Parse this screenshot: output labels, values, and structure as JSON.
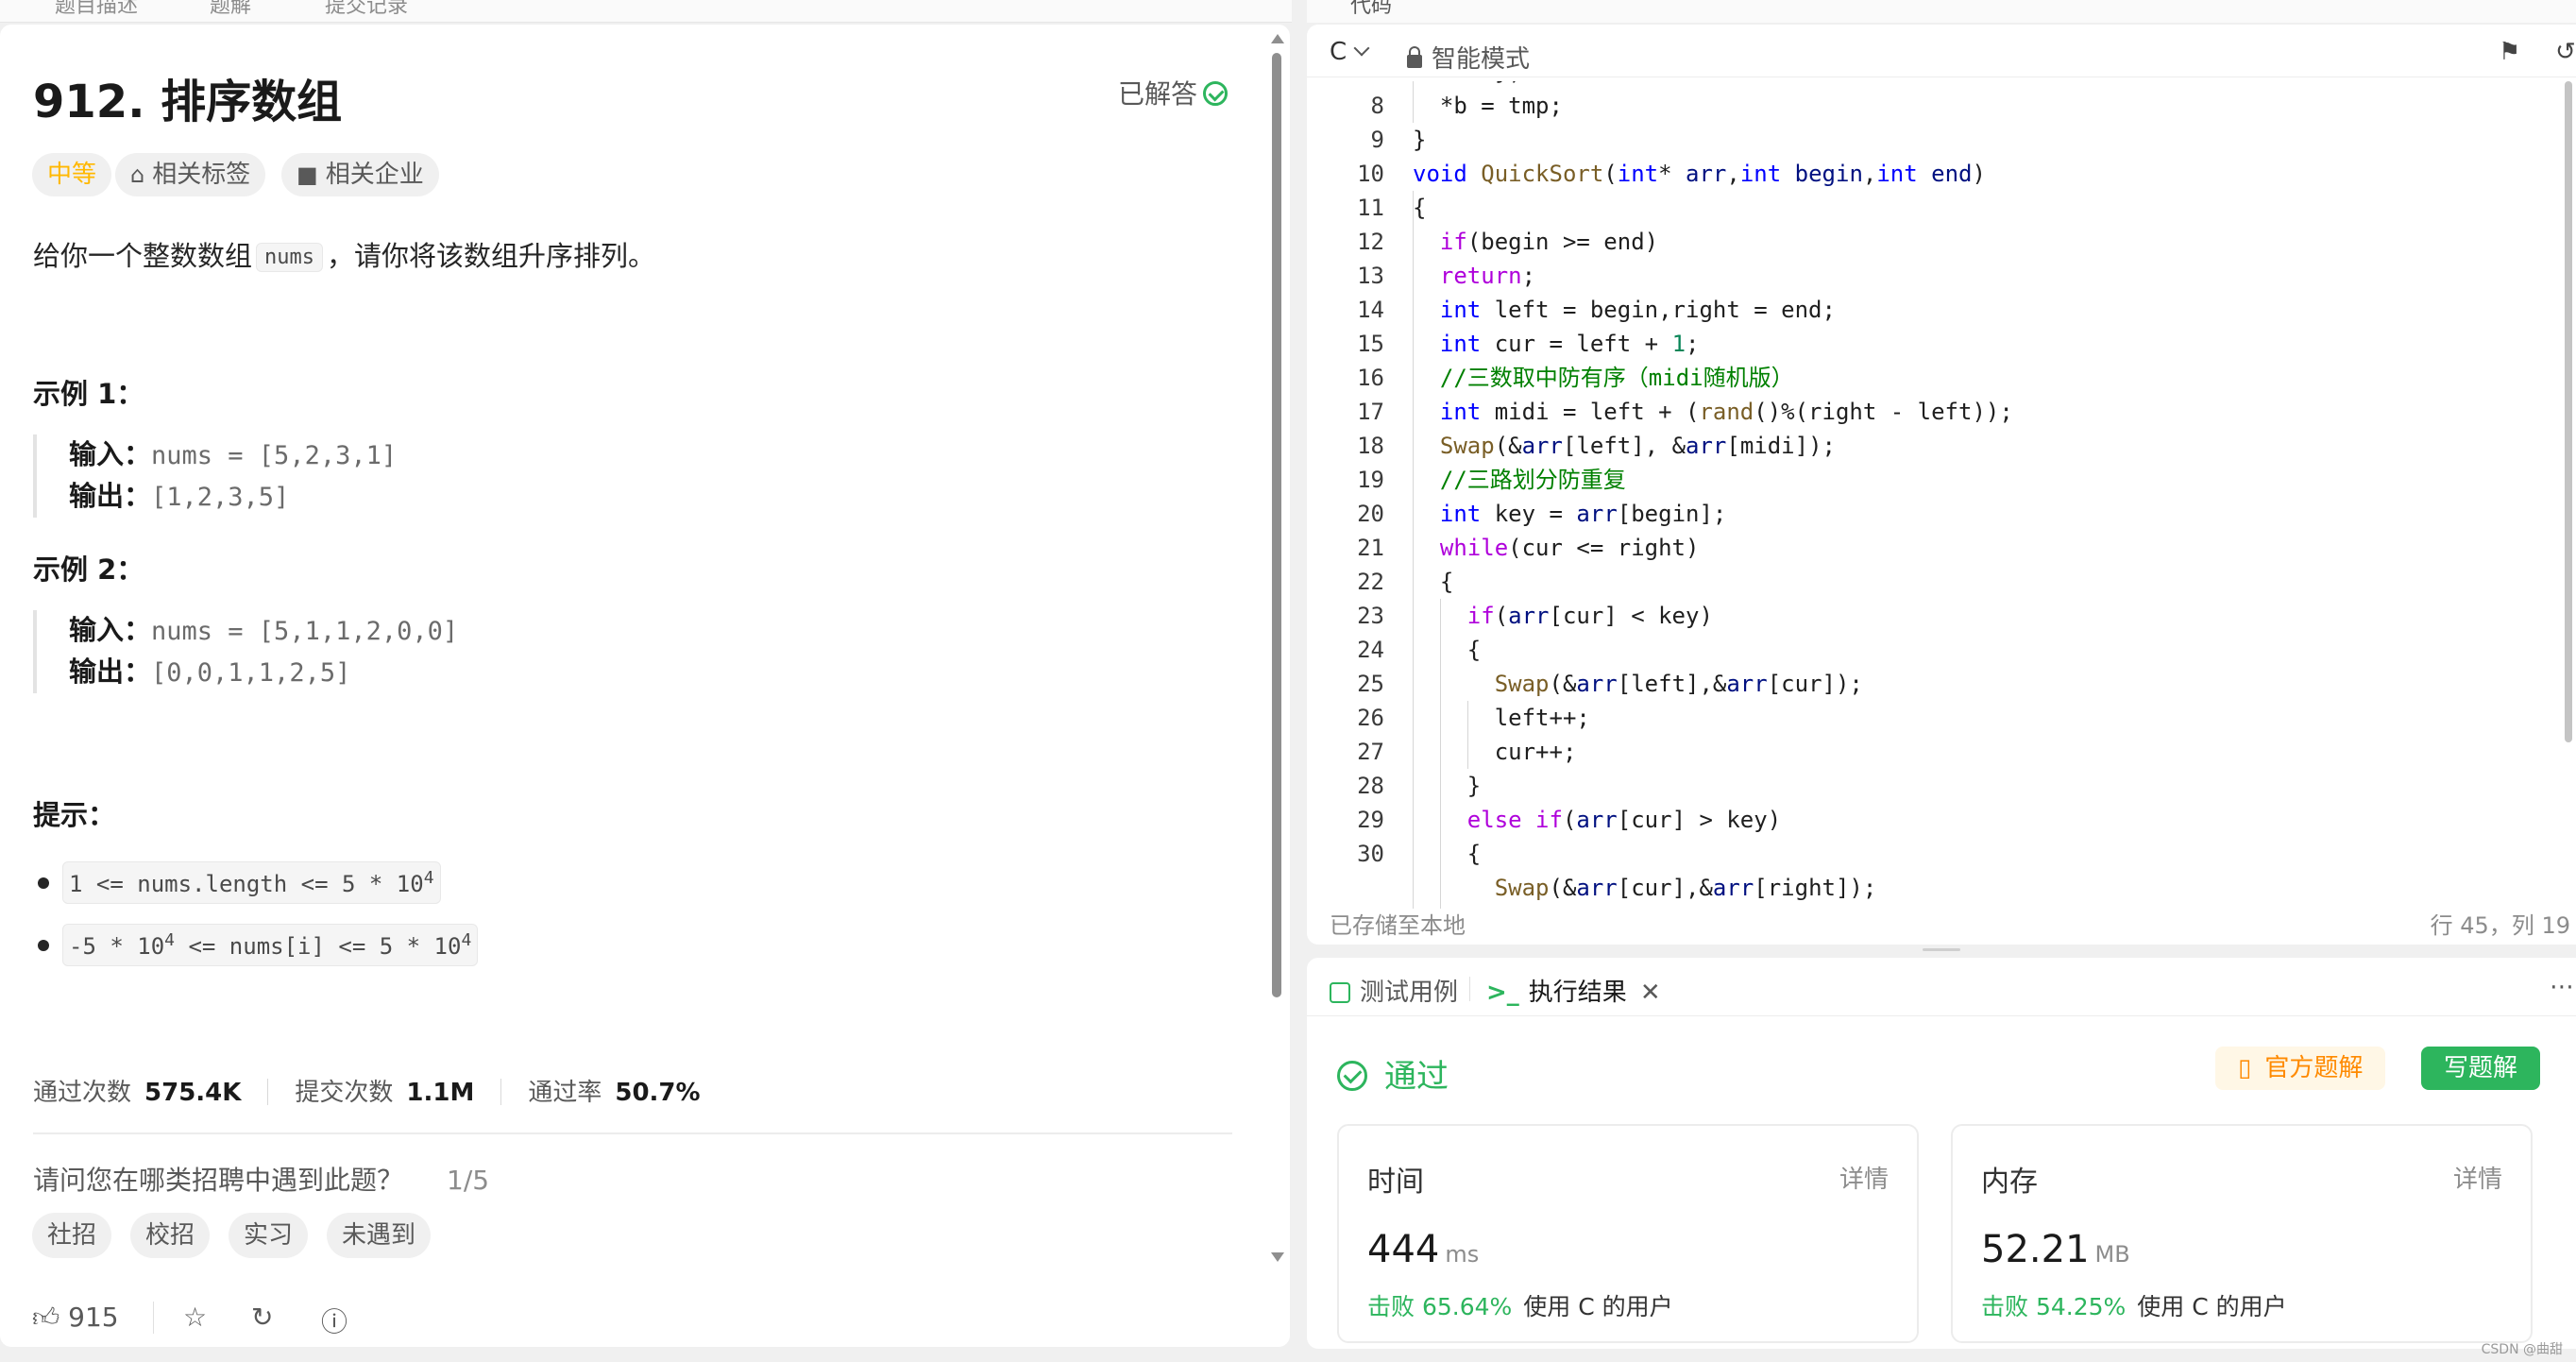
{
  "top_tabs_left": [
    "题目描述",
    "题解",
    "提交记录"
  ],
  "top_tab_right": "代码",
  "problem": {
    "title": "912. 排序数组",
    "solved_label": "已解答",
    "difficulty": "中等",
    "tag_label": "相关标签",
    "company_label": "相关企业",
    "desc_before": "给你一个整数数组",
    "desc_code": "nums",
    "desc_after": "，请你将该数组升序排列。",
    "example1_title": "示例 1：",
    "example2_title": "示例 2：",
    "input_label": "输入：",
    "output_label": "输出：",
    "example1_input": "nums = [5,2,3,1]",
    "example1_output": "[1,2,3,5]",
    "example2_input": "nums = [5,1,1,2,0,0]",
    "example2_output": "[0,0,1,1,2,5]",
    "hint_title": "提示：",
    "hint1": "1 <= nums.length <= 5 * 10",
    "hint1_exp": "4",
    "hint2_a": "-5 * 10",
    "hint2_exp_a": "4",
    "hint2_b": " <= nums[i] <= 5 * 10",
    "hint2_exp_b": "4"
  },
  "stats": {
    "accept_label": "通过次数",
    "accept_value": "575.4K",
    "submit_label": "提交次数",
    "submit_value": "1.1M",
    "rate_label": "通过率",
    "rate_value": "50.7%"
  },
  "survey": {
    "question": "请问您在哪类招聘中遇到此题？",
    "page": "1/5",
    "options": [
      "社招",
      "校招",
      "实习",
      "未遇到"
    ]
  },
  "footer": {
    "likes": "915"
  },
  "editor": {
    "language": "C",
    "mode": "智能模式",
    "status_left": "已存储至本地",
    "status_right": "行 45，列 19"
  },
  "result": {
    "tab_testcase": "测试用例",
    "tab_result": "执行结果",
    "status": "通过",
    "official_btn": "官方题解",
    "write_btn": "写题解",
    "time_title": "时间",
    "time_value": "444",
    "time_unit": "ms",
    "time_beat": "击败 65.64%",
    "time_users": "使用 C 的用户",
    "mem_title": "内存",
    "mem_value": "52.21",
    "mem_unit": "MB",
    "mem_beat": "击败 54.25%",
    "mem_users": "使用 C 的用户",
    "detail_label": "详情"
  },
  "watermark": "CSDN @曲甜",
  "colors": {
    "accent_green": "#2db55d",
    "difficulty_yellow": "#ffb800",
    "official_orange": "#ff8a00"
  }
}
